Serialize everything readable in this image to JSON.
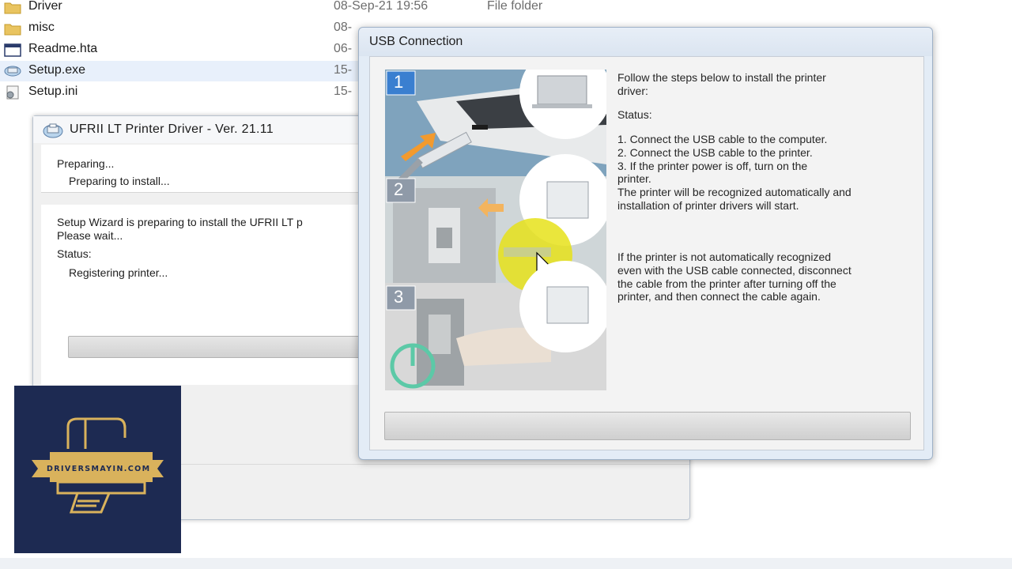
{
  "explorer": {
    "files": [
      {
        "name": "Driver",
        "date": "08-Sep-21 19:56",
        "type": "File folder",
        "icon": "folder-icon"
      },
      {
        "name": "misc",
        "date": "08-",
        "type": "",
        "icon": "folder-icon"
      },
      {
        "name": "Readme.hta",
        "date": "06-",
        "type": "",
        "icon": "hta-file-icon"
      },
      {
        "name": "Setup.exe",
        "date": "15-",
        "type": "",
        "icon": "setup-exe-icon"
      },
      {
        "name": "Setup.ini",
        "date": "15-",
        "type": "",
        "icon": "settings-file-icon"
      }
    ]
  },
  "wizard": {
    "title": "UFRII LT Printer Driver - Ver. 21.11",
    "heading": "Preparing...",
    "subheading": "Preparing to install...",
    "message_line1": "Setup Wizard is preparing to install the UFRII LT p",
    "message_line2": "Please wait...",
    "status_label": "Status:",
    "status_value": "Registering printer..."
  },
  "usb_dialog": {
    "title": "USB Connection",
    "intro": "Follow the steps below to install the printer\ndriver:",
    "status_label": "Status:",
    "steps": "1. Connect the USB cable to the computer.\n2. Connect the USB cable to the printer.\n3. If the printer power is off, turn on the\nprinter.\nThe printer will be recognized automatically and\ninstallation of printer drivers will start.",
    "note": "If the printer is not automatically recognized\neven with the USB cable connected, disconnect\nthe cable from the printer after turning off the\nprinter, and then connect the cable again.",
    "step_badges": [
      "1",
      "2",
      "3"
    ]
  },
  "watermark": {
    "text": "DRIVERSMAYIN.COM"
  },
  "colors": {
    "dialog_frame": "#e3ecf6",
    "badge_blue": "#3a7fd0",
    "badge_grey": "#8f9aa8",
    "logo_navy": "#1d2a52",
    "logo_gold": "#d9b25c",
    "highlight_yellow": "#e6e21a",
    "power_green": "#5cc9a7"
  }
}
